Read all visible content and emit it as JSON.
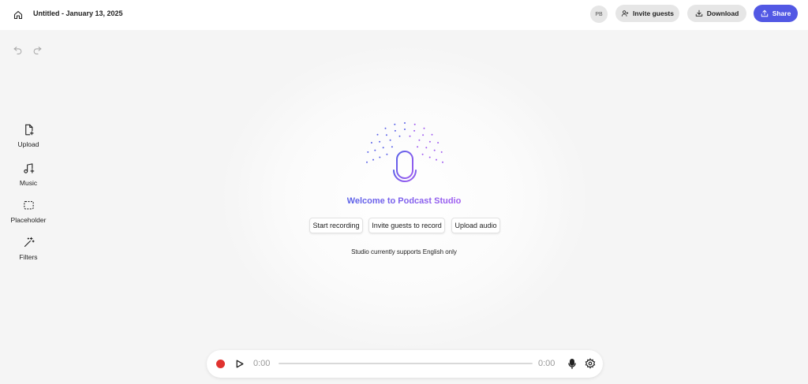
{
  "header": {
    "title": "Untitled - January 13, 2025",
    "avatar_initials": "PB",
    "invite_label": "Invite guests",
    "download_label": "Download",
    "share_label": "Share"
  },
  "toolbar": {
    "items": [
      {
        "label": "Upload",
        "icon": "upload-file-icon"
      },
      {
        "label": "Music",
        "icon": "music-note-icon"
      },
      {
        "label": "Placeholder",
        "icon": "placeholder-icon"
      },
      {
        "label": "Filters",
        "icon": "magic-wand-icon"
      }
    ]
  },
  "main": {
    "welcome": "Welcome to Podcast Studio",
    "actions": {
      "start_recording": "Start recording",
      "invite_guests": "Invite guests to record",
      "upload_audio": "Upload audio"
    },
    "note": "Studio currently supports English only"
  },
  "player": {
    "time_start": "0:00",
    "time_end": "0:00",
    "progress": 0
  },
  "colors": {
    "accent": "#5258e4",
    "record": "#e0322f",
    "gradient_start": "#5a61e8",
    "gradient_end": "#a05cf0"
  }
}
